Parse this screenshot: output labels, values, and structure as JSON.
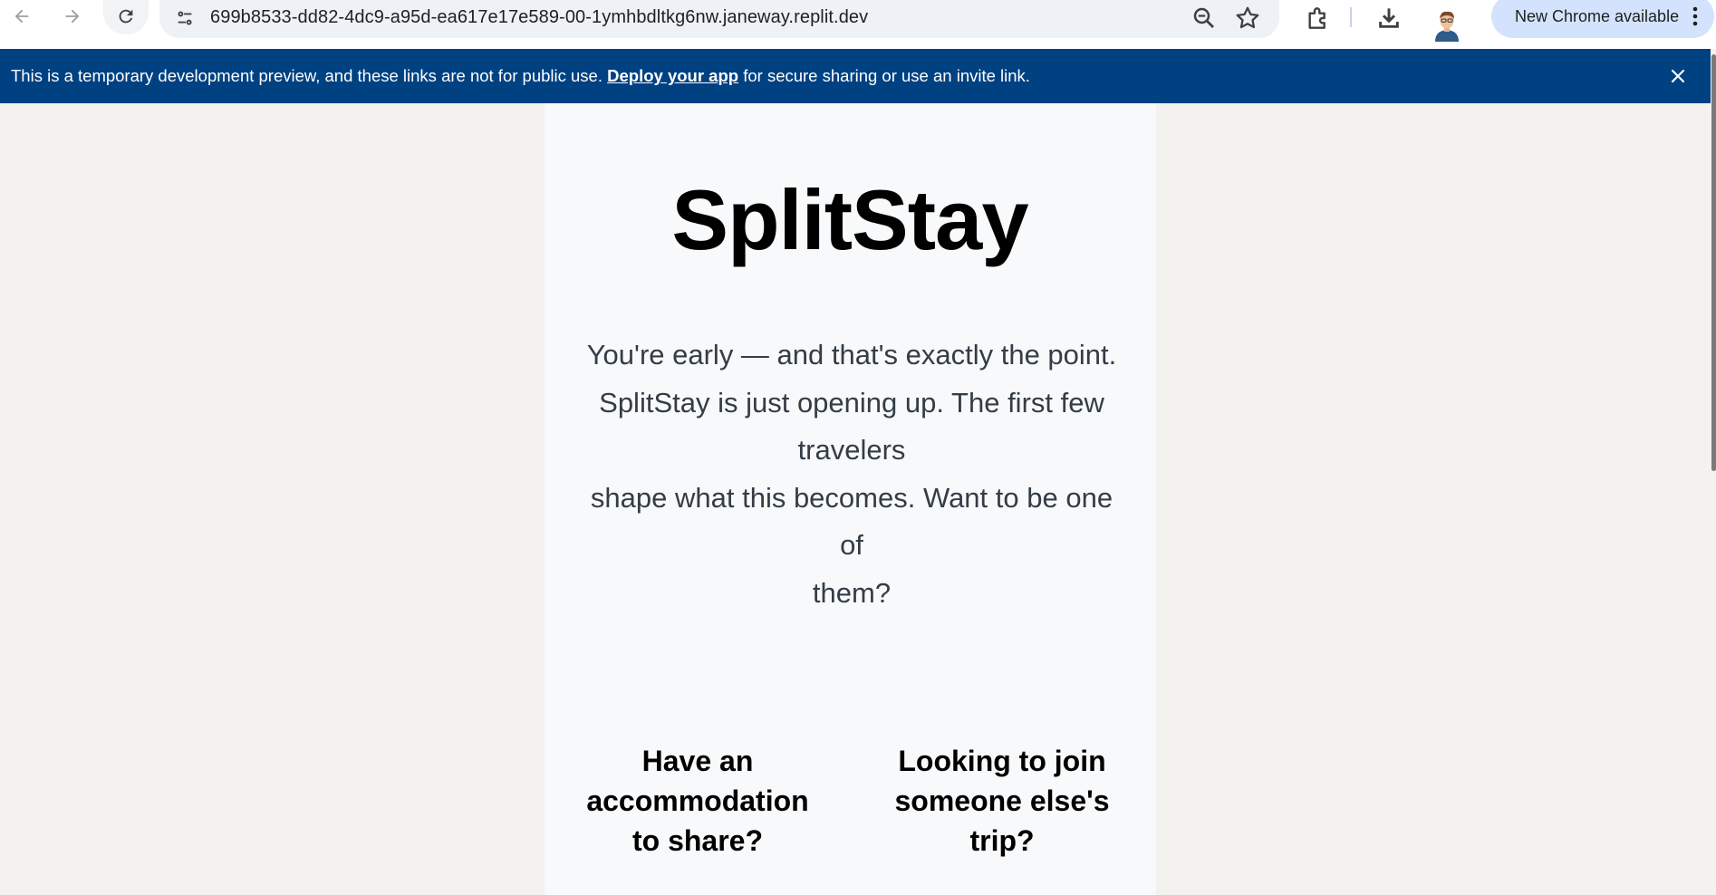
{
  "browser": {
    "url": "699b8533-dd82-4dc9-a95d-ea617e17e589-00-1ymhbdltkg6nw.janeway.replit.dev",
    "update_label": "New Chrome available",
    "icons": [
      "back-icon",
      "forward-icon",
      "reload-icon",
      "site-info-icon",
      "zoom-icon",
      "star-icon",
      "extensions-icon",
      "download-icon",
      "avatar",
      "more-icon"
    ]
  },
  "banner": {
    "text_before": "This is a temporary development preview, and these links are not for public use.",
    "link": "Deploy your app",
    "text_after": "for secure sharing or use an invite link."
  },
  "page": {
    "logo": "SplitStay",
    "intro_lines": [
      "You're early — and that's exactly the point.",
      "SplitStay is just opening up. The first few travelers",
      "shape what this becomes. Want to be one of",
      "them?"
    ],
    "cta_host": "Have an accommodation to share?",
    "cta_guest": "Looking to join someone else's trip?"
  },
  "colors": {
    "banner_bg": "#004182",
    "page_bg": "#f4f2ee",
    "card_bg": "#f8f9fa",
    "update_chip": "#d3e3fd"
  }
}
